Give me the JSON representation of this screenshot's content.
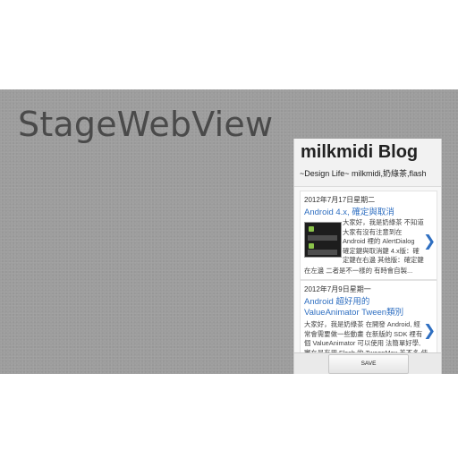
{
  "stage": {
    "title": "StageWebView"
  },
  "webview": {
    "blog_title": "milkmidi Blog",
    "blog_subtitle": "~Design Life~ milkmidi,奶綠茶,flash",
    "posts": [
      {
        "date": "2012年7月17日星期二",
        "title": "Android 4.x, 確定與取消",
        "excerpt_lines": [
          "大家好，我是奶綠茶 不知道",
          "大家有沒有注意到在",
          "Android 裡的 AlertDialog",
          "確定鍵與取消鍵 4.x版：確",
          "定鍵在右邊 其他版：確定鍵",
          "在左邊 二者是不一樣的 有時會自製..."
        ]
      },
      {
        "date": "2012年7月9日星期一",
        "title_lines": [
          "Android 超好用的",
          "ValueAnimator Tween類別"
        ],
        "excerpt_lines": [
          "大家好，我是奶綠茶 在開發 Android, 經",
          "常會需要做一些動畫 在新版的 SDK 裡有",
          "個 ValueAnimator 可以使用 法簡單好學,",
          "實在是有用 Flash 的 TweenMax 差不多 使"
        ]
      }
    ],
    "save_label": "SAVE"
  }
}
